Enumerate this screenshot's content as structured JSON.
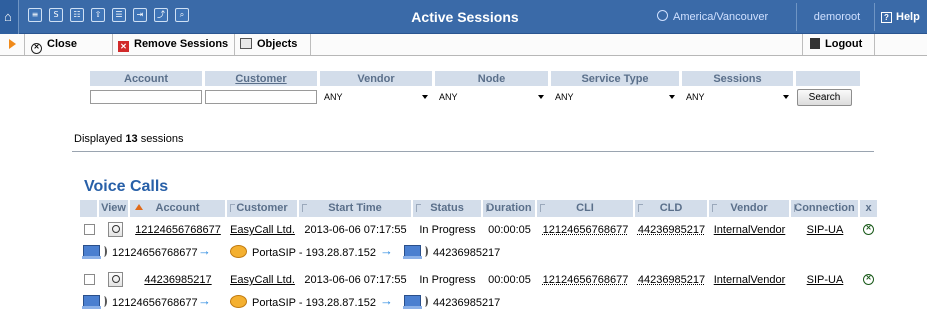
{
  "topbar": {
    "home_icon": "home-icon",
    "icon_glyphs": [
      "≡",
      "S",
      "☷",
      "⇧",
      "☰",
      "⇥",
      "⤴",
      "⌕"
    ],
    "icon_names": [
      "list-icon",
      "dollar-icon",
      "grid-icon",
      "upload-icon",
      "table-icon",
      "export-icon",
      "chart-icon",
      "search-icon"
    ],
    "title": "Active Sessions",
    "timezone": "America/Vancouver",
    "user": "demoroot",
    "help": "Help"
  },
  "toolbar": {
    "close": "Close",
    "remove_sessions": "Remove Sessions",
    "objects": "Objects",
    "logout": "Logout"
  },
  "filter": {
    "headers": [
      "Account",
      "Customer",
      "Vendor",
      "Node",
      "Service Type",
      "Sessions"
    ],
    "vendor_value": "ANY",
    "node_value": "ANY",
    "service_type_value": "ANY",
    "sessions_value": "ANY",
    "search_button": "Search"
  },
  "summary": {
    "prefix": "Displayed",
    "count": "13",
    "suffix": "sessions"
  },
  "section_title": "Voice Calls",
  "table": {
    "columns": [
      "View",
      "Account",
      "Customer",
      "Start Time",
      "Status",
      "Duration",
      "CLI",
      "CLD",
      "Vendor",
      "Connection",
      "x"
    ],
    "rows": [
      {
        "account": "12124656768677",
        "customer": "EasyCall Ltd.",
        "start_time": "2013-06-06 07:17:55",
        "status": "In Progress",
        "duration": "00:00:05",
        "cli": "12124656768677",
        "cld": "44236985217",
        "vendor": "InternalVendor",
        "connection": "SIP-UA",
        "flow_from": "12124656768677",
        "flow_node": "PortaSIP - 193.28.87.152",
        "flow_to": "44236985217"
      },
      {
        "account": "44236985217",
        "customer": "EasyCall Ltd.",
        "start_time": "2013-06-06 07:17:55",
        "status": "In Progress",
        "duration": "00:00:05",
        "cli": "12124656768677",
        "cld": "44236985217",
        "vendor": "InternalVendor",
        "connection": "SIP-UA",
        "flow_from": "12124656768677",
        "flow_node": "PortaSIP - 193.28.87.152",
        "flow_to": "44236985217"
      }
    ]
  },
  "colors": {
    "topbar_bg": "#3a6aa8",
    "header_bg": "#d3ddea",
    "header_text": "#5a6f8a",
    "section_title": "#2860a8",
    "accent_orange": "#f08a1a",
    "remove_red": "#d12a2a"
  }
}
